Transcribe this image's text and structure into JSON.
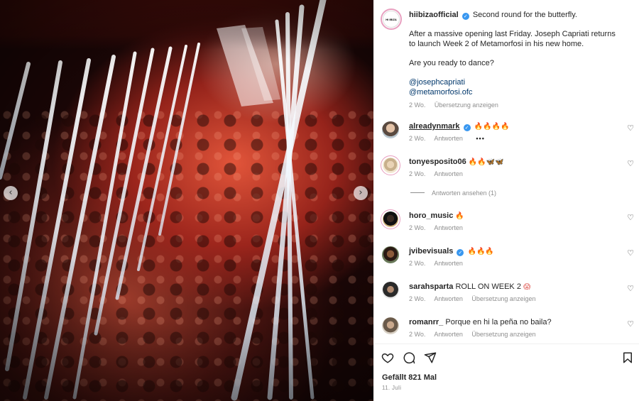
{
  "post": {
    "username": "hiibizaofficial",
    "avatar_logo": "HI IBIZA",
    "caption_lead": "Second round for the butterfly.",
    "caption_body": "After a massive opening last Friday. Joseph Capriati returns to launch Week 2 of Metamorfosi in his new home.",
    "caption_question": "Are you ready to dance?",
    "mentions": [
      "@josephcapriati",
      "@metamorfosi.ofc"
    ],
    "age": "2 Wo.",
    "translate_label": "Übersetzung anzeigen"
  },
  "comments": [
    {
      "user": "alreadynmark",
      "verified": true,
      "text": "",
      "emoji": "🔥🔥🔥🔥",
      "age": "2 Wo.",
      "reply": "Antworten",
      "more": "•••"
    },
    {
      "user": "tonyesposito06",
      "verified": false,
      "text": "",
      "emoji": "🔥🔥🦋🦋",
      "age": "2 Wo.",
      "reply": "Antworten"
    },
    {
      "user": "horo_music",
      "verified": false,
      "text": "",
      "emoji": "🔥",
      "age": "2 Wo.",
      "reply": "Antworten"
    },
    {
      "user": "jvibevisuals",
      "verified": true,
      "text": "",
      "emoji": "🔥🔥🔥",
      "age": "2 Wo.",
      "reply": "Antworten"
    },
    {
      "user": "sarahsparta",
      "verified": false,
      "text": "ROLL ON WEEK 2",
      "emoji": "😱",
      "age": "2 Wo.",
      "reply": "Antworten",
      "translate": "Übersetzung anzeigen"
    },
    {
      "user": "romanrr_",
      "verified": false,
      "text": "Porque en hi la peña no baila?",
      "emoji": "",
      "age": "2 Wo.",
      "reply": "Antworten",
      "translate": "Übersetzung anzeigen"
    }
  ],
  "view_replies": "Antworten ansehen (1)",
  "actions": {
    "icons": [
      "heart-icon",
      "comment-icon",
      "share-icon",
      "bookmark-icon"
    ],
    "likes": "Gefällt 821 Mal",
    "date": "11. Juli"
  },
  "colors": {
    "accent_link": "#00376b",
    "verified": "#3897f0",
    "muted": "#8e8e8e"
  }
}
